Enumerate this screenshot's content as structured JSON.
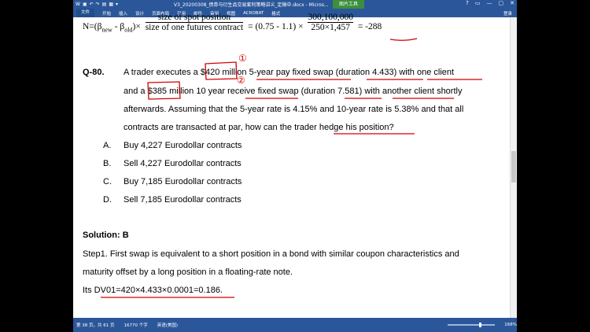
{
  "window": {
    "title": "V3_20200308_债券与衍生品交易套利策略讲义_定稿中.docx - Micros...",
    "context_tab": "图片工具",
    "controls": [
      "?",
      "▭",
      "—",
      "▢",
      "✕"
    ]
  },
  "ribbon": {
    "tabs": [
      "文件",
      "开始",
      "插入",
      "设计",
      "页面布局",
      "引用",
      "邮件",
      "审阅",
      "视图",
      "ACROBAT",
      "格式"
    ],
    "signin": "登录"
  },
  "formula": {
    "lhs": "N=(β",
    "sub_new": "new",
    "minus": " - β",
    "sub_old": "old",
    "close": ")×",
    "frac1_num": "size of spot position",
    "frac1_den": "size of one futures contract",
    "eq": "= (0.75 - 1.1) ×",
    "frac2_num": "300,100,000",
    "frac2_den": "250×1,457",
    "result": "= -288"
  },
  "question": {
    "label": "Q-80.",
    "line1": "A trader executes a $420 million 5-year pay fixed swap (duration 4.433) with one client",
    "line2": "and a $385 million 10 year receive fixed swap (duration 7.581) with another client shortly",
    "line3": "afterwards. Assuming that the 5-year rate is 4.15% and 10-year rate is 5.38% and that all",
    "line4": "contracts are transacted at par, how can the trader hedge his position?",
    "options": [
      {
        "letter": "A.",
        "text": "Buy 4,227 Eurodollar contracts"
      },
      {
        "letter": "B.",
        "text": "Sell 4,227 Eurodollar contracts"
      },
      {
        "letter": "C.",
        "text": "Buy 7,185 Eurodollar contracts"
      },
      {
        "letter": "D.",
        "text": "Sell 7,185 Eurodollar contracts"
      }
    ]
  },
  "solution": {
    "title": "Solution: B",
    "step1_a": "Step1. First swap is equivalent to a short position in a bond with similar coupon characteristics and",
    "step1_b": "maturity offset by a long position in a floating-rate note.",
    "dv01": "Its  DV01=420×4.433×0.0001=0.186."
  },
  "annotations": {
    "mark1": "①",
    "mark2": "②",
    "color": "#d40000"
  },
  "status": {
    "page": "第 38 页，共 61 页",
    "words": "16770 个字",
    "lang": "英语(美国)",
    "zoom": "168%"
  }
}
